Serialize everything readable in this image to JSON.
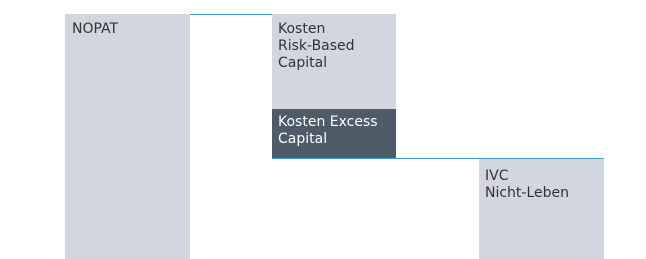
{
  "diagram": {
    "blocks": [
      {
        "id": "nopat",
        "label": "NOPAT",
        "color": "#d3d6de"
      },
      {
        "id": "risk_based_capital",
        "label": "Kosten\nRisk-Based\nCapital",
        "color": "#d3d6de"
      },
      {
        "id": "excess_capital",
        "label": "Kosten Excess\nCapital",
        "color": "#4e5b68"
      },
      {
        "id": "ivc",
        "label": "IVC\nNicht-Leben",
        "color": "#d3d6de"
      }
    ],
    "rule_color": "#3aa0c8"
  }
}
